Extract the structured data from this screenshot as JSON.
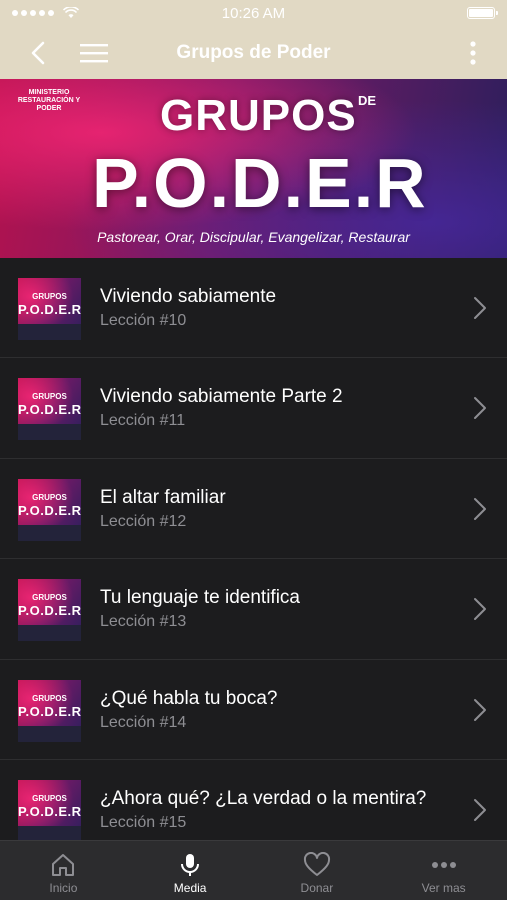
{
  "status_bar": {
    "time": "10:26 AM"
  },
  "nav": {
    "title": "Grupos de Poder"
  },
  "banner": {
    "ministry": "MINISTERIO RESTAURACIÓN Y PODER",
    "grupos": "GRUPOS",
    "de": "DE",
    "poder": "P.O.D.E.R",
    "tagline": "Pastorear, Orar, Discipular, Evangelizar, Restaurar"
  },
  "thumb": {
    "grupos": "GRUPOS",
    "poder": "P.O.D.E.R"
  },
  "items": [
    {
      "title": "Viviendo sabiamente",
      "subtitle": "Lección #10"
    },
    {
      "title": "Viviendo sabiamente Parte 2",
      "subtitle": "Lección #11"
    },
    {
      "title": "El altar familiar",
      "subtitle": "Lección #12"
    },
    {
      "title": "Tu lenguaje te identifica",
      "subtitle": "Lección #13"
    },
    {
      "title": "¿Qué habla tu boca?",
      "subtitle": "Lección #14"
    },
    {
      "title": "¿Ahora qué?  ¿La verdad o la mentira?",
      "subtitle": "Lección #15"
    }
  ],
  "tabs": [
    {
      "label": "Inicio",
      "icon": "home-icon"
    },
    {
      "label": "Media",
      "icon": "microphone-icon",
      "active": true
    },
    {
      "label": "Donar",
      "icon": "heart-icon"
    },
    {
      "label": "Ver mas",
      "icon": "more-icon"
    }
  ],
  "colors": {
    "nav_bg": "#e1d9c4",
    "list_bg": "#1c1c1e",
    "tab_bg": "#2c2c2e",
    "accent_pink": "#b3124e"
  }
}
